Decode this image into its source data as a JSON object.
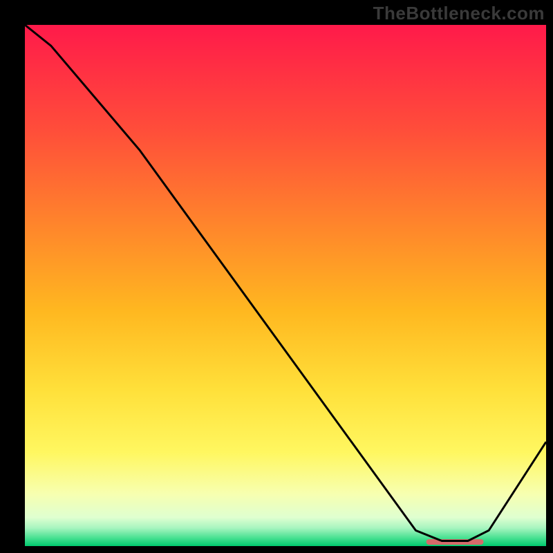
{
  "watermark": "TheBottleneck.com",
  "chart_data": {
    "type": "line",
    "title": "",
    "xlabel": "",
    "ylabel": "",
    "xlim": [
      0,
      100
    ],
    "ylim": [
      0,
      100
    ],
    "grid": false,
    "legend": false,
    "x": [
      0,
      5,
      22,
      75,
      80,
      85,
      89,
      100
    ],
    "values": [
      100,
      96,
      76,
      3,
      1,
      1,
      3,
      20
    ],
    "marker": {
      "x_range": [
        77,
        88
      ],
      "y": 0.8
    },
    "background_gradient": {
      "stops": [
        {
          "pos": 0.0,
          "color": "#ff1a4a"
        },
        {
          "pos": 0.2,
          "color": "#ff4d3a"
        },
        {
          "pos": 0.4,
          "color": "#ff8a2a"
        },
        {
          "pos": 0.55,
          "color": "#ffb820"
        },
        {
          "pos": 0.7,
          "color": "#ffe03a"
        },
        {
          "pos": 0.82,
          "color": "#fff760"
        },
        {
          "pos": 0.9,
          "color": "#f7ffb0"
        },
        {
          "pos": 0.945,
          "color": "#dfffd0"
        },
        {
          "pos": 0.965,
          "color": "#a8f5c0"
        },
        {
          "pos": 0.985,
          "color": "#45e090"
        },
        {
          "pos": 1.0,
          "color": "#00c96e"
        }
      ]
    },
    "line_color": "#000000",
    "marker_color": "#d66a6a"
  }
}
